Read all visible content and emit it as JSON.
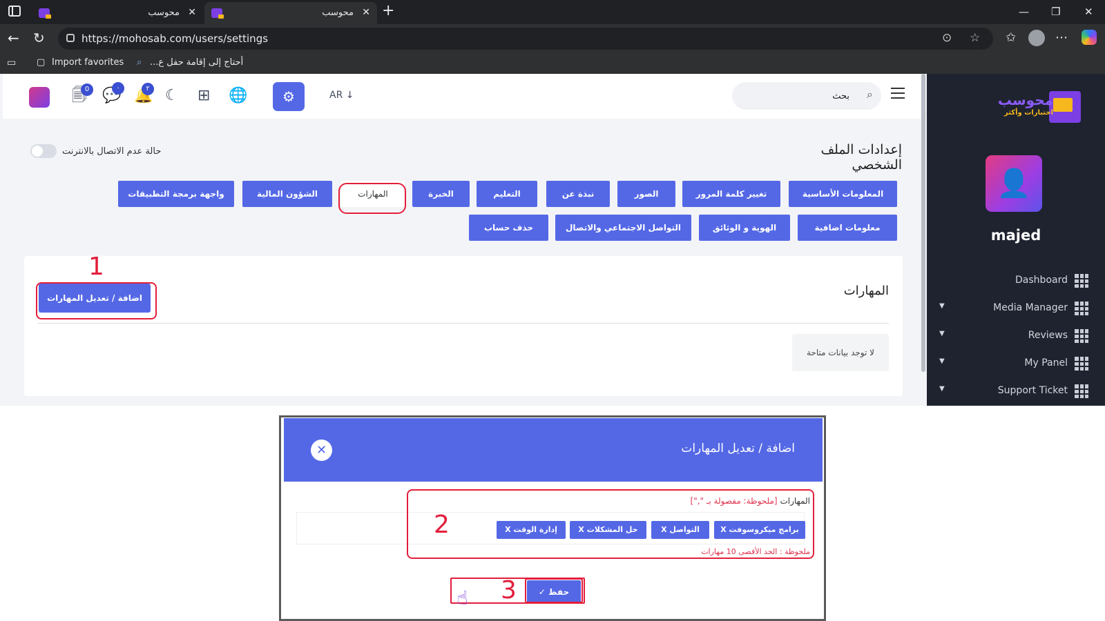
{
  "browser": {
    "tabs": [
      {
        "title": "محوسب",
        "active": false
      },
      {
        "title": "محوسب",
        "active": true
      }
    ],
    "url": "https://mohosab.com/users/settings",
    "favorites": [
      "Import favorites",
      "أحتاج إلى إقامة حفل ع..."
    ]
  },
  "topnav": {
    "badges": {
      "cart": "0",
      "chat": "٠",
      "bell": "٢"
    },
    "lang": "AR",
    "search_placeholder": "بحث"
  },
  "page": {
    "title": "إعدادات الملف الشخصي",
    "offline_label": "حالة عدم الاتصال بالانترنت",
    "tabs_row1": [
      "المعلومات الأساسية",
      "تغيير كلمة المرور",
      "الصور",
      "نبذة عن",
      "التعليم",
      "الخبرة",
      "المهارات",
      "الشؤون المالية",
      "واجهة برمجة التطبيقات"
    ],
    "tabs_row2": [
      "معلومات اضافية",
      "الهوية و الوثائق",
      "التواصل الاجتماعي والاتصال",
      "حذف حساب"
    ],
    "active_tab": "المهارات"
  },
  "card": {
    "title": "المهارات",
    "button": "اضافة / تعديل المهارات",
    "empty": "لا توجد بيانات متاحة"
  },
  "sidebar": {
    "logo_title": "محوسب",
    "logo_subtitle": "اختبارات وأكثر",
    "username": "majed",
    "items": [
      {
        "label": "Dashboard",
        "caret": false
      },
      {
        "label": "Media Manager",
        "caret": true
      },
      {
        "label": "Reviews",
        "caret": true
      },
      {
        "label": "My Panel",
        "caret": true
      },
      {
        "label": "Support Ticket",
        "caret": true
      }
    ]
  },
  "modal": {
    "title": "اضافة / تعديل المهارات",
    "skills_label": "المهارات",
    "skills_note": "[ملحوظة: مفصولة بـ \",\"]",
    "chips": [
      "برامج ميكروسوفت X",
      "التواصل X",
      "حل المشكلات X",
      "إدارة الوقت X"
    ],
    "max_note": "ملحوظة : الحد الأقصى 10 مهارات",
    "save": "حفظ ✓"
  },
  "annotations": [
    "1",
    "2",
    "3"
  ],
  "colors": {
    "primary": "#5468e6",
    "sidebar_bg": "#1e232f",
    "highlight": "#e31d3b"
  }
}
